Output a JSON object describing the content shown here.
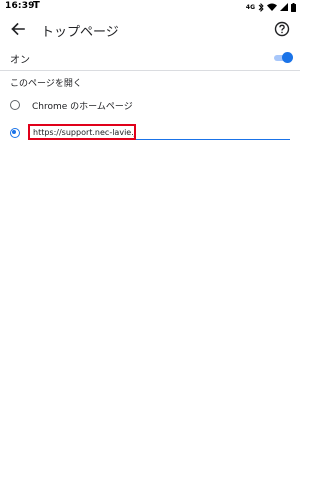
{
  "status_bar": {
    "time": "16:39",
    "notification": "T",
    "indicator_text": "4G"
  },
  "app_bar": {
    "title": "トップページ"
  },
  "toggle": {
    "label": "オン",
    "on": true
  },
  "section": {
    "header": "このページを開く",
    "options": [
      {
        "label": "Chrome のホームページ",
        "selected": false
      },
      {
        "value": "https://support.nec-lavie.jp/",
        "selected": true
      }
    ]
  },
  "colors": {
    "accent": "#1a73e8",
    "highlight_border": "#e0001a"
  }
}
